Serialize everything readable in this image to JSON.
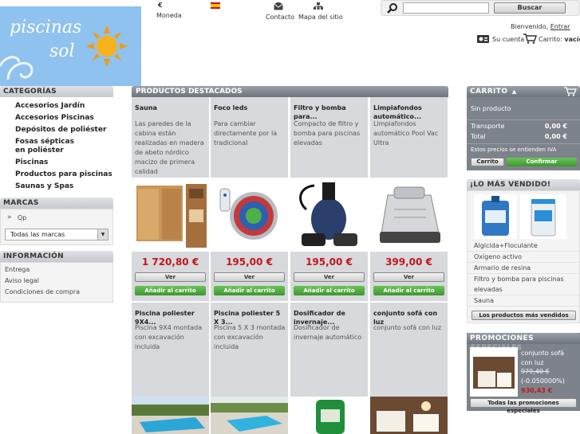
{
  "header": {
    "logo_line1": "piscinas",
    "logo_line2": "sol",
    "currency_symbol": "€",
    "currency_label": "Moneda",
    "contact_label": "Contacto",
    "sitemap_label": "Mapa del sitio",
    "search_placeholder": "",
    "search_button": "Buscar",
    "welcome_text": "Bienvenido,",
    "login_link": "Entrar",
    "account_label": "Su cuenta",
    "cart_label": "Carrito:",
    "cart_status": "vacío"
  },
  "categories": {
    "title": "CATEGORÍAS",
    "items": [
      "Accesorios Jardín",
      "Accesorios Piscinas",
      "Depósitos de poliéster",
      "Fosas sépticas en poliéster",
      "Piscinas",
      "Productos para piscinas",
      "Saunas y Spas"
    ]
  },
  "brands": {
    "title": "MARCAS",
    "item": "Qp",
    "select_value": "Todas las marcas"
  },
  "information": {
    "title": "INFORMACIÓN",
    "items": [
      "Entrega",
      "Aviso legal",
      "Condiciones de compra"
    ]
  },
  "featured": {
    "title": "PRODUCTOS DESTACADOS",
    "view_label": "Ver",
    "add_label": "Añadir al carrito",
    "products": [
      {
        "name": "Sauna",
        "desc": "Las paredes de la cabina están realizadas en madera de abeto nórdico macizo de primera calidad",
        "price": "1 720,80 €"
      },
      {
        "name": "Foco leds",
        "desc": "Para cambiar directamente por la tradicional",
        "price": "195,00 €"
      },
      {
        "name": "Filtro y bomba para...",
        "desc": "Compacto de filtro y bomba para piscinas elevadas",
        "price": "195,00 €"
      },
      {
        "name": "Limpiafondos automático...",
        "desc": "Limpiafondos automático Pool Vac Ultra",
        "price": "399,00 €"
      },
      {
        "name": "Piscina poliester 9X4...",
        "desc": "Piscina 9X4 montada con excavación incluida"
      },
      {
        "name": "Piscina poliester 5 X 3...",
        "desc": "Piscina 5 X 3 montada con excavación incluida"
      },
      {
        "name": "Dosificador de invernaje...",
        "desc": "Dosificador de invernaje automático"
      },
      {
        "name": "conjunto sofá con luz",
        "desc": "conjunto sofá con luz"
      }
    ]
  },
  "cart": {
    "title": "CARRITO",
    "empty": "Sin producto",
    "shipping_label": "Transporte",
    "shipping_value": "0,00 €",
    "total_label": "Total",
    "total_value": "0,00 €",
    "tax_note": "Estos precios se entienden IVA",
    "cart_button": "Carrito",
    "confirm_button": "Confirmar"
  },
  "bestsellers": {
    "title": "¡LO MÁS VENDIDO!",
    "items": [
      "Algicida+Floculante",
      "Oxígeno activo",
      "Armario de resina",
      "Filtro y bomba para piscinas elevadas",
      "Sauna"
    ],
    "button": "Los productos más vendidos"
  },
  "promotions": {
    "title": "PROMOCIONES",
    "title_overflow": "ESPECIALES",
    "product_name": "conjunto sofá con luz",
    "old_price": "979,40 €",
    "discount": "(-0.050000%)",
    "new_price": "930,43 €",
    "button": "Todas las promociones especiales"
  },
  "colors": {
    "price_red": "#c0171b",
    "button_green": "#3d962f",
    "logo_sky": "#8fc2ee"
  }
}
